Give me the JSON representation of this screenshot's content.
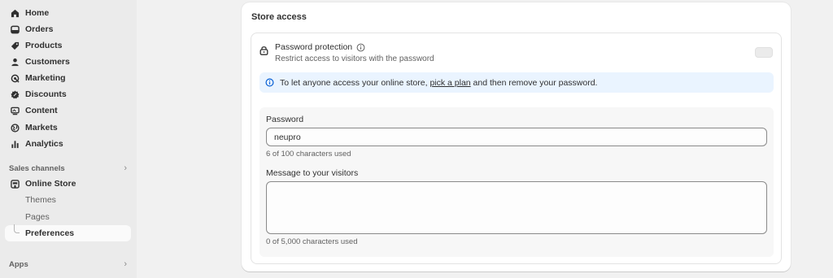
{
  "sidebar": {
    "items": [
      {
        "label": "Home",
        "icon": "home-icon"
      },
      {
        "label": "Orders",
        "icon": "inbox-icon"
      },
      {
        "label": "Products",
        "icon": "tag-icon"
      },
      {
        "label": "Customers",
        "icon": "person-icon"
      },
      {
        "label": "Marketing",
        "icon": "target-icon"
      },
      {
        "label": "Discounts",
        "icon": "discount-icon"
      },
      {
        "label": "Content",
        "icon": "content-icon"
      },
      {
        "label": "Markets",
        "icon": "globe-icon"
      },
      {
        "label": "Analytics",
        "icon": "bar-chart-icon"
      }
    ],
    "sales_channels_label": "Sales channels",
    "online_store": {
      "label": "Online Store",
      "sub_items": [
        "Themes",
        "Pages",
        "Preferences"
      ],
      "active": "Preferences"
    },
    "apps_label": "Apps"
  },
  "store_access": {
    "title": "Store access",
    "password_protection": {
      "title": "Password protection",
      "description": "Restrict access to visitors with the password",
      "enabled": false
    },
    "banner": {
      "before": "To let anyone access your online store, ",
      "link": "pick a plan",
      "after": " and then remove your password."
    },
    "password_label": "Password",
    "password_value": "neupro",
    "password_help": "6 of 100 characters used",
    "message_label": "Message to your visitors",
    "message_value": "",
    "message_help": "0 of 5,000 characters used"
  },
  "colors": {
    "sidebar_bg": "#ebebeb",
    "page_bg": "#f1f1f1",
    "banner_bg": "#eaf4ff",
    "info_blue": "#005bd3"
  }
}
